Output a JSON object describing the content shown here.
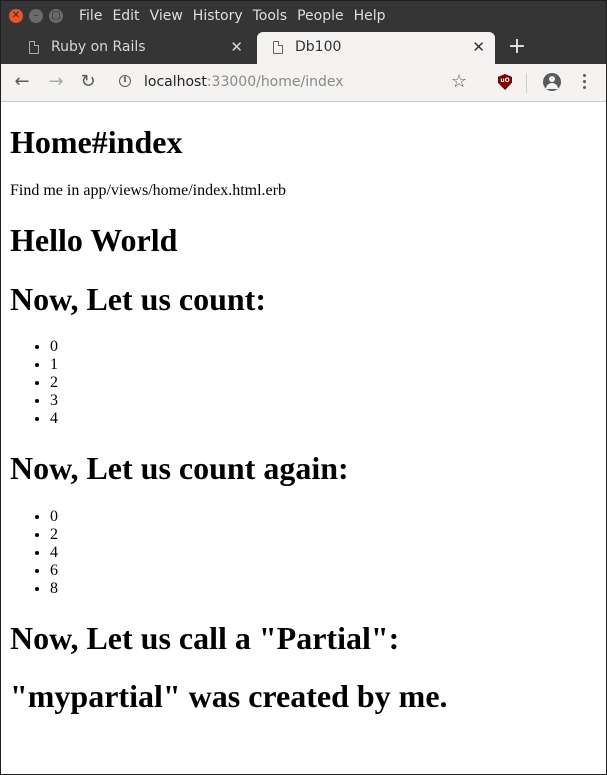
{
  "menubar": {
    "items": [
      "File",
      "Edit",
      "View",
      "History",
      "Tools",
      "People",
      "Help"
    ]
  },
  "tabs": [
    {
      "title": "Ruby on Rails",
      "active": false
    },
    {
      "title": "Db100",
      "active": true
    }
  ],
  "toolbar": {
    "url_host": "localhost",
    "url_rest": ":33000/home/index"
  },
  "page": {
    "heading_main": "Home#index",
    "find_me": "Find me in app/views/home/index.html.erb",
    "hello": "Hello World",
    "count_heading": "Now, Let us count:",
    "count_items": [
      "0",
      "1",
      "2",
      "3",
      "4"
    ],
    "count_again_heading": "Now, Let us count again:",
    "count_again_items": [
      "0",
      "2",
      "4",
      "6",
      "8"
    ],
    "partial_heading": "Now, Let us call a \"Partial\":",
    "partial_text": "\"mypartial\" was created by me."
  },
  "colors": {
    "titlebar": "#353535",
    "close_button": "#e6552c",
    "toolbar": "#f4f3f2",
    "ublock": "#800000"
  }
}
